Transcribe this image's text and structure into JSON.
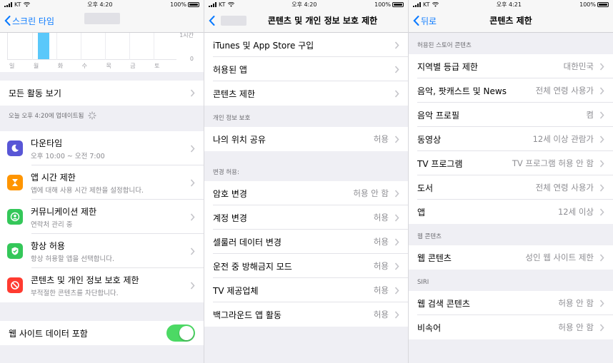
{
  "status": [
    {
      "carrier": "KT",
      "time": "오후 4:20",
      "battery": "100%"
    },
    {
      "carrier": "KT",
      "time": "오후 4:20",
      "battery": "100%"
    },
    {
      "carrier": "KT",
      "time": "오후 4:21",
      "battery": "100%"
    }
  ],
  "screen1": {
    "back_label": "스크린 타임",
    "chart": {
      "y_labels": [
        "1시간",
        "0"
      ],
      "days": [
        "일",
        "월",
        "화",
        "수",
        "목",
        "금",
        "토"
      ]
    },
    "all_activity": "모든 활동 보기",
    "update_text": "오늘 오후 4:20에 업데이트됨",
    "items": [
      {
        "title": "다운타임",
        "subtitle": "오후 10:00 ~ 오전 7:00",
        "color": "#5856d6",
        "icon": "moon-icon"
      },
      {
        "title": "앱 시간 제한",
        "subtitle": "앱에 대해 사용 시간 제한을 설정합니다.",
        "color": "#ff9500",
        "icon": "hourglass-icon"
      },
      {
        "title": "커뮤니케이션 제한",
        "subtitle": "연락처 관리 중",
        "color": "#34c759",
        "icon": "contact-icon"
      },
      {
        "title": "항상 허용",
        "subtitle": "항상 허용할 앱을 선택합니다.",
        "color": "#34c759",
        "icon": "checkmark-icon"
      },
      {
        "title": "콘텐츠 및 개인 정보 보호 제한",
        "subtitle": "부적절한 콘텐츠를 차단합니다.",
        "color": "#ff3b30",
        "icon": "block-icon"
      }
    ],
    "web_data": "웹 사이트 데이터 포함"
  },
  "screen2": {
    "title": "콘텐츠 및 개인 정보 보호 제한",
    "top_items": [
      "iTunes 및 App Store 구입",
      "허용된 앱",
      "콘텐츠 제한"
    ],
    "privacy_header": "개인 정보 보호",
    "location": {
      "label": "나의 위치 공유",
      "value": "허용"
    },
    "changes_header": "변경 허용:",
    "changes": [
      {
        "label": "암호 변경",
        "value": "허용 안 함"
      },
      {
        "label": "계정 변경",
        "value": "허용"
      },
      {
        "label": "셀룰러 데이터 변경",
        "value": "허용"
      },
      {
        "label": "운전 중 방해금지 모드",
        "value": "허용"
      },
      {
        "label": "TV 제공업체",
        "value": "허용"
      },
      {
        "label": "백그라운드 앱 활동",
        "value": "허용"
      }
    ]
  },
  "screen3": {
    "back_label": "뒤로",
    "title": "콘텐츠 제한",
    "store_header": "허용된 스토어 콘텐츠",
    "store": [
      {
        "label": "지역별 등급 제한",
        "value": "대한민국"
      },
      {
        "label": "음악, 팟캐스트 및 News",
        "value": "전체 연령 사용가"
      },
      {
        "label": "음악 프로필",
        "value": "켬"
      },
      {
        "label": "동영상",
        "value": "12세 이상 관람가"
      },
      {
        "label": "TV 프로그램",
        "value": "TV 프로그램 허용 안 함"
      },
      {
        "label": "도서",
        "value": "전체 연령 사용가"
      },
      {
        "label": "앱",
        "value": "12세 이상"
      }
    ],
    "web_header": "웹 콘텐츠",
    "web": {
      "label": "웹 콘텐츠",
      "value": "성인 웹 사이트 제한"
    },
    "siri_header": "SIRI",
    "siri": [
      {
        "label": "웹 검색 콘텐츠",
        "value": "허용 안 함"
      },
      {
        "label": "비속어",
        "value": "허용 안 함"
      }
    ]
  }
}
